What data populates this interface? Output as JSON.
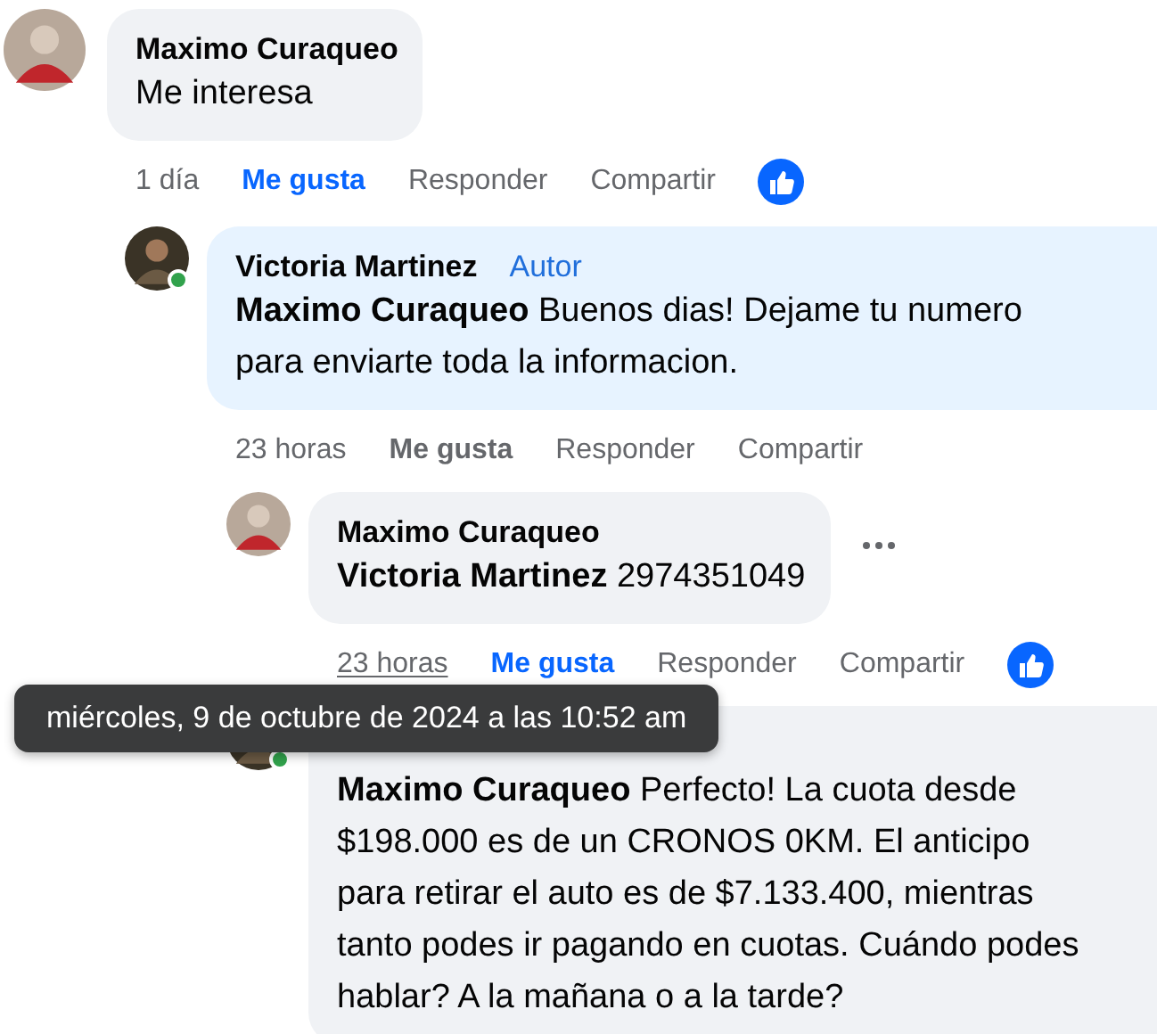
{
  "comments": [
    {
      "author": "Maximo Curaqueo",
      "text": "Me interesa",
      "online": false,
      "time": "1 día",
      "time_hovered": false,
      "like_label": "Me gusta",
      "liked": true,
      "reply_label": "Responder",
      "share_label": "Compartir",
      "has_reaction": true,
      "show_menu": false,
      "children": [
        {
          "author": "Victoria Martinez",
          "badge": "Autor",
          "mention": "Maximo Curaqueo",
          "text": "Buenos dias! Dejame tu numero para enviarte toda la informacion.",
          "online": true,
          "time": "23 horas",
          "time_hovered": false,
          "like_label": "Me gusta",
          "liked": false,
          "reply_label": "Responder",
          "share_label": "Compartir",
          "has_reaction": false,
          "show_menu": false,
          "children": [
            {
              "author": "Maximo Curaqueo",
              "mention": "Victoria Martinez",
              "text": "2974351049",
              "online": false,
              "time": "23 horas",
              "time_hovered": true,
              "like_label": "Me gusta",
              "liked": true,
              "reply_label": "Responder",
              "share_label": "Compartir",
              "has_reaction": true,
              "show_menu": true
            },
            {
              "mention": "Maximo Curaqueo",
              "text": "Perfecto! La cuota desde $198.000 es de un CRONOS 0KM. El anticipo para retirar el auto es de $7.133.400, mientras tanto podes ir pagando en cuotas. Cuándo podes hablar? A la mañana o a la tarde?",
              "online": true,
              "show_menu": false
            }
          ]
        }
      ]
    }
  ],
  "tooltip": {
    "text": "miércoles, 9 de octubre de 2024 a las 10:52 am"
  }
}
